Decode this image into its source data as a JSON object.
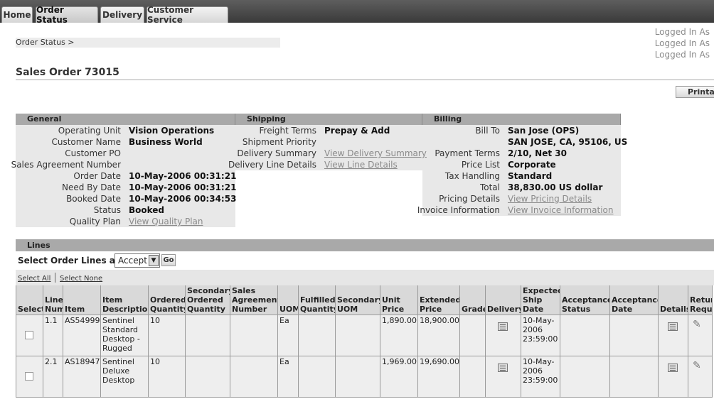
{
  "tabs": [
    "Home",
    "Order Status",
    "Delivery",
    "Customer Service"
  ],
  "logged_in": [
    "Logged In As",
    "Logged In As",
    "Logged In As"
  ],
  "breadcrumb": "Order Status  >",
  "page_title": "Sales Order 73015",
  "print_label": "Printal",
  "sections": {
    "general": "General",
    "shipping": "Shipping",
    "billing": "Billing"
  },
  "general": {
    "labels": [
      "Operating Unit",
      "Customer Name",
      "Customer PO",
      "Sales Agreement Number",
      "Order Date",
      "Need By Date",
      "Booked Date",
      "Status",
      "Quality Plan"
    ],
    "values": [
      "Vision Operations",
      "Business World",
      "",
      "",
      "10-May-2006 00:31:21",
      "10-May-2006 00:31:21",
      "10-May-2006 00:34:53",
      "Booked",
      "View Quality Plan"
    ]
  },
  "shipping": {
    "labels": [
      "Freight Terms",
      "Shipment Priority",
      "Delivery Summary",
      "Delivery Line Details"
    ],
    "values": [
      "Prepay & Add",
      "",
      "View Delivery Summary",
      "View Line Details"
    ]
  },
  "billing": {
    "labels": [
      "Bill To",
      "",
      "Payment Terms",
      "Price List",
      "Tax Handling",
      "Total",
      "Pricing Details",
      "Invoice Information"
    ],
    "values": [
      "San Jose (OPS)",
      "SAN JOSE, CA, 95106, US",
      "2/10, Net 30",
      "Corporate",
      "Standard",
      "38,830.00 US dollar",
      "View Pricing Details",
      "View Invoice Information"
    ]
  },
  "lines": {
    "title": "Lines",
    "select_label": "Select Order Lines and :",
    "action_selected": "Accept",
    "go_label": "Go",
    "select_all": "Select All",
    "select_none": "Select None",
    "headers": [
      "Select",
      "Line Num",
      "Item",
      "Item Description",
      "Ordered Quantity",
      "Secondary Ordered Quantity",
      "Sales Agreement Number",
      "UOM",
      "Fulfilled Quantity",
      "Secondary UOM",
      "Unit Price",
      "Extended Price",
      "Grade",
      "Delivery",
      "Expected Ship Date",
      "Acceptance Status",
      "Acceptance Date",
      "Details",
      "Return Reque"
    ],
    "rows": [
      {
        "line": "1.1",
        "item": "AS54999",
        "desc": "Sentinel Standard Desktop - Rugged",
        "qty": "10",
        "uom": "Ea",
        "unit_price": "1,890.00",
        "ext_price": "18,900.00",
        "ship_date": "10-May-2006 23:59:00"
      },
      {
        "line": "2.1",
        "item": "AS18947",
        "desc": "Sentinel Deluxe Desktop",
        "qty": "10",
        "uom": "Ea",
        "unit_price": "1,969.00",
        "ext_price": "19,690.00",
        "ship_date": "10-May-2006 23:59:00"
      }
    ]
  }
}
